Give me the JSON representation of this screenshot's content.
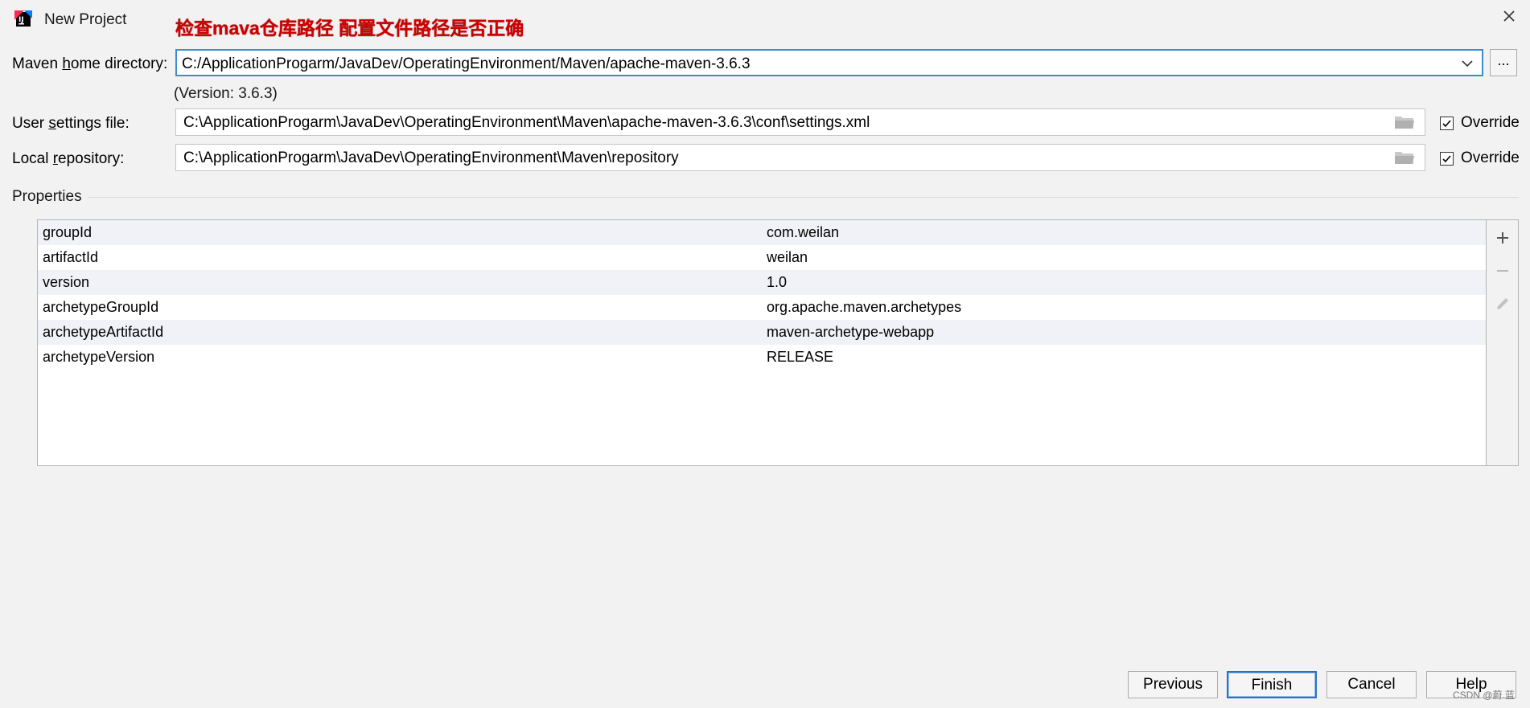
{
  "window": {
    "title": "New Project",
    "annotation": "检查mava仓库路径 配置文件路径是否正确"
  },
  "maven_home": {
    "label_prefix": "Maven ",
    "label_underlined": "h",
    "label_suffix": "ome directory:",
    "value": "C:/ApplicationProgarm/JavaDev/OperatingEnvironment/Maven/apache-maven-3.6.3",
    "browse_label": "...",
    "version": "(Version: 3.6.3)"
  },
  "user_settings": {
    "label_prefix": "User ",
    "label_underlined": "s",
    "label_suffix": "ettings file:",
    "value": "C:\\ApplicationProgarm\\JavaDev\\OperatingEnvironment\\Maven\\apache-maven-3.6.3\\conf\\settings.xml",
    "override_label": "Override",
    "override_checked": true
  },
  "local_repo": {
    "label_prefix": "Local ",
    "label_underlined": "r",
    "label_suffix": "epository:",
    "value": "C:\\ApplicationProgarm\\JavaDev\\OperatingEnvironment\\Maven\\repository",
    "override_label": "Override",
    "override_checked": true
  },
  "properties": {
    "title": "Properties",
    "rows": [
      {
        "key": "groupId",
        "value": "com.weilan"
      },
      {
        "key": "artifactId",
        "value": "weilan"
      },
      {
        "key": "version",
        "value": "1.0"
      },
      {
        "key": "archetypeGroupId",
        "value": "org.apache.maven.archetypes"
      },
      {
        "key": "archetypeArtifactId",
        "value": "maven-archetype-webapp"
      },
      {
        "key": "archetypeVersion",
        "value": "RELEASE"
      }
    ]
  },
  "buttons": {
    "previous": "Previous",
    "finish": "Finish",
    "cancel": "Cancel",
    "help": "Help"
  },
  "watermark": "CSDN @蔚.蓝",
  "colors": {
    "focus_border": "#3d8bd4",
    "annotation_red": "#d10000",
    "row_alt": "#f0f2f7"
  }
}
